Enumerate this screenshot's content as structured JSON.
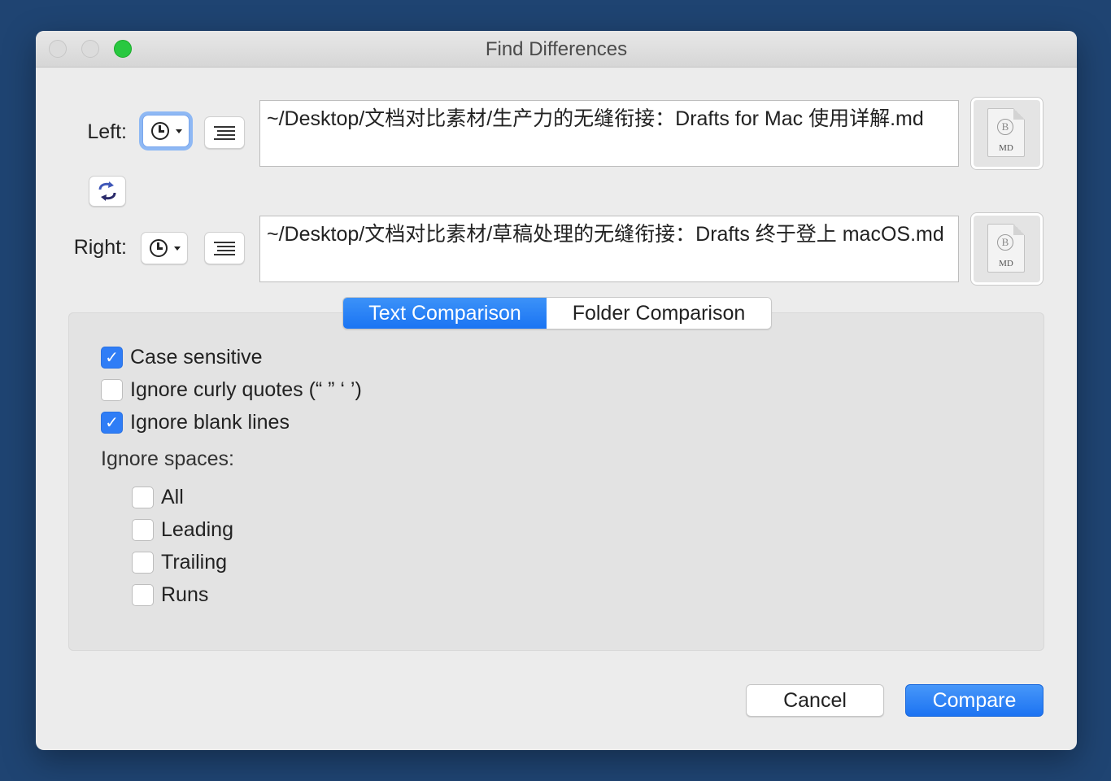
{
  "window": {
    "title": "Find Differences"
  },
  "left": {
    "label": "Left:",
    "path": "~/Desktop/文档对比素材/生产力的无缝衔接：Drafts for Mac 使用详解.md",
    "file_type": "MD",
    "file_badge": "B"
  },
  "right": {
    "label": "Right:",
    "path": "~/Desktop/文档对比素材/草稿处理的无缝衔接：Drafts 终于登上 macOS.md",
    "file_type": "MD",
    "file_badge": "B"
  },
  "tabs": [
    {
      "label": "Text Comparison",
      "selected": true
    },
    {
      "label": "Folder Comparison",
      "selected": false
    }
  ],
  "options": [
    {
      "label": "Case sensitive",
      "checked": true
    },
    {
      "label": "Ignore curly quotes (“ ” ‘ ’)",
      "checked": false
    },
    {
      "label": "Ignore blank lines",
      "checked": true
    }
  ],
  "ignore_spaces": {
    "label": "Ignore spaces:",
    "items": [
      {
        "label": "All",
        "checked": false
      },
      {
        "label": "Leading",
        "checked": false
      },
      {
        "label": "Trailing",
        "checked": false
      },
      {
        "label": "Runs",
        "checked": false
      }
    ]
  },
  "buttons": {
    "cancel": "Cancel",
    "compare": "Compare"
  },
  "colors": {
    "accent": "#1a74f3",
    "background": "#1f4472",
    "zoom_light": "#28c840"
  }
}
